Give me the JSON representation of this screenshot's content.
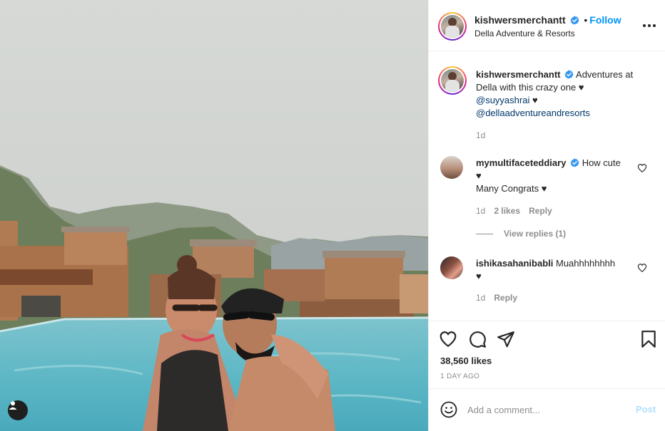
{
  "post": {
    "author": "kishwersmerchantt",
    "follow_label": "Follow",
    "location": "Della Adventure & Resorts",
    "caption": {
      "text": "Adventures at Della with this crazy one",
      "mention_inline_suffix": "@suyyashrai",
      "mention_2": "@dellaadventureandresorts",
      "heart": "♥",
      "time": "1d"
    },
    "likes": "38,560 likes",
    "date": "1 DAY AGO"
  },
  "comments": [
    {
      "author": "mymultifaceteddiary",
      "line1": "How cute",
      "heart": "♥",
      "line2": "Many Congrats",
      "time": "1d",
      "likes": "2 likes",
      "reply_label": "Reply",
      "view_replies": "View replies (1)"
    },
    {
      "author": "ishikasahanibabli",
      "line1": "Muahhhhhhhh",
      "heart": "♥",
      "time": "1d",
      "reply_label": "Reply"
    }
  ],
  "composer": {
    "placeholder": "Add a comment...",
    "post_label": "Post"
  },
  "icons": {
    "more": "more-options-icon",
    "like": "heart-icon",
    "comment": "comment-icon",
    "share": "share-icon",
    "save": "bookmark-icon",
    "emoji": "emoji-icon",
    "tag": "user-tag-icon",
    "verified": "verified-badge-icon"
  },
  "colors": {
    "follow": "#0095f6",
    "verified": "#3897f0",
    "link": "#00376b",
    "muted": "#8e8e8e",
    "post_disabled": "#b2dffc"
  }
}
